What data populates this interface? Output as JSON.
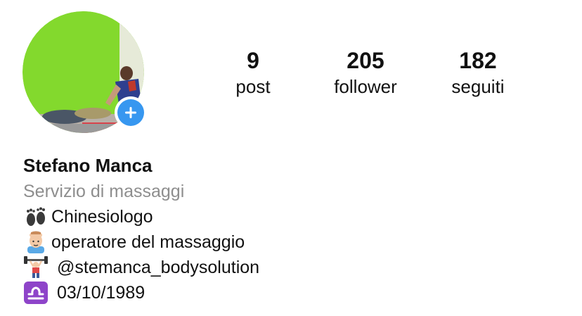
{
  "profile": {
    "name": "Stefano Manca",
    "category": "Servizio di massaggi"
  },
  "stats": {
    "posts": {
      "value": "9",
      "label": "post"
    },
    "followers": {
      "value": "205",
      "label": "follower"
    },
    "following": {
      "value": "182",
      "label": "seguiti"
    }
  },
  "bio": {
    "lines": [
      {
        "icon": "footprints-icon",
        "text": "Chinesiologo"
      },
      {
        "icon": "person-massage-icon",
        "text": "operatore del massaggio"
      },
      {
        "icon": "weightlifter-icon",
        "text": "@stemanca_bodysolution"
      },
      {
        "icon": "libra-icon",
        "text": "03/10/1989"
      }
    ]
  },
  "colors": {
    "accent_blue": "#3797f0",
    "secondary_text": "#8e8e8e",
    "libra_purple": "#8e44c9"
  }
}
